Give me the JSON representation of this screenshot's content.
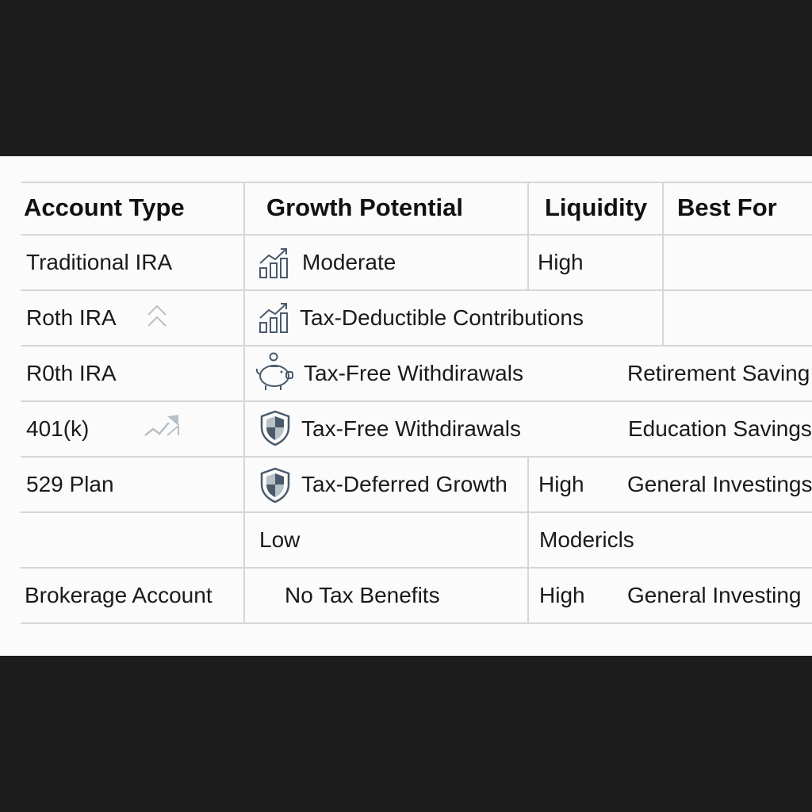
{
  "table": {
    "headers": [
      "Account Type",
      "Growth Potential",
      "Liquidity",
      "Best For"
    ],
    "rows": [
      {
        "account_type": "Traditional IRA",
        "growth_potential": "Moderate",
        "liquidity": "High",
        "best_for": "",
        "growth_icon": "bar-chart-up-icon"
      },
      {
        "account_type": "Roth IRA",
        "account_icon": "double-chevron-up-icon",
        "growth_potential": "Tax-Deductible Contributions",
        "growth_icon": "bar-chart-up-icon"
      },
      {
        "account_type": "R0th IRA",
        "growth_potential": "Tax-Free Withdirawals",
        "best_for": "Retirement Saving",
        "growth_icon": "piggy-bank-icon"
      },
      {
        "account_type": "401(k)",
        "account_icon": "trend-arrow-icon",
        "growth_potential": "Tax-Free Withdirawals",
        "best_for": "Education Savings",
        "growth_icon": "shield-icon"
      },
      {
        "account_type": "529 Plan",
        "growth_potential": "Tax-Deferred Growth",
        "liquidity": "High",
        "best_for": "General Investings",
        "growth_icon": "shield-icon"
      },
      {
        "account_type": "",
        "growth_potential": "Low",
        "liquidity": "Modericls",
        "best_for": ""
      },
      {
        "account_type": "Brokerage Account",
        "growth_potential": "No Tax Benefits",
        "liquidity": "High",
        "best_for": "General Investing"
      }
    ]
  },
  "colors": {
    "background": "#1c1c1c",
    "table_background": "#fbfbfb",
    "grid_line": "#d6d6d6",
    "icon_stroke": "#4a5a6a",
    "icon_light": "#b8c0c8"
  }
}
